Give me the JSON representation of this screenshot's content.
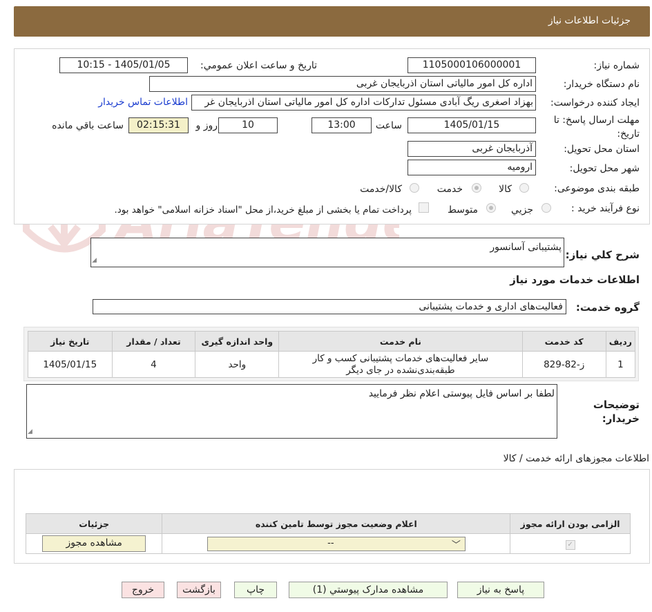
{
  "header": {
    "title": "جزئیات اطلاعات نیاز"
  },
  "form": {
    "need_number_label": "شماره نیاز:",
    "need_number": "1105000106000001",
    "announce_label": "تاریخ و ساعت اعلان عمومي:",
    "announce_value": "1405/01/05 - 10:15",
    "buyer_org_label": "نام دستگاه خریدار:",
    "buyer_org": "اداره کل امور مالیاتی استان اذربایجان غربی",
    "creator_label": "ایجاد کننده درخواست:",
    "creator": "بهزاد اصغری ریگ آبادی مسئول تدارکات اداره کل امور مالیاتی استان اذربایجان غر",
    "contact_link": "اطلاعات تماس خریدار",
    "deadline_label": "مهلت ارسال پاسخ: تا تاریخ:",
    "deadline_date": "1405/01/15",
    "time_label": "ساعت",
    "deadline_time": "13:00",
    "days": "10",
    "days_label": "روز و",
    "remaining": "02:15:31",
    "remaining_label": "ساعت باقي مانده",
    "province_label": "استان محل تحویل:",
    "province": "آذربایجان غربی",
    "city_label": "شهر محل تحویل:",
    "city": "ارومیه",
    "category_label": "طبقه بندی موضوعی:",
    "category_options": [
      "کالا",
      "خدمت",
      "کالا/خدمت"
    ],
    "category_selected": "خدمت",
    "process_label": "نوع فرآیند خرید :",
    "process_options": [
      "جزيي",
      "متوسط"
    ],
    "process_selected": "متوسط",
    "payment_note": "پرداخت تمام یا بخشی از مبلغ خرید،از محل \"اسناد خزانه اسلامی\" خواهد بود."
  },
  "summary": {
    "label": "شرح کلي نیاز:",
    "value": "پشتیبانی آسانسور"
  },
  "services": {
    "section_title": "اطلاعات خدمات مورد نیاز",
    "group_label": "گروه خدمت:",
    "group_value": "فعالیت‌های اداری و خدمات پشتیبانی",
    "columns": [
      "ردیف",
      "کد خدمت",
      "نام خدمت",
      "واحد اندازه گیری",
      "تعداد / مقدار",
      "تاریخ نیاز"
    ],
    "rows": [
      {
        "row": "1",
        "code": "ز-82-829",
        "name_line1": "سایر فعالیت‌های خدمات پشتیبانی کسب و کار",
        "name_line2": "طبقه‌بندی‌نشده در جای دیگر",
        "unit": "واحد",
        "qty": "4",
        "date": "1405/01/15"
      }
    ]
  },
  "buyer_notes": {
    "label": "توضیحات خریدار:",
    "value": "لطفا بر اساس فایل پیوستی اعلام نظر فرمایید"
  },
  "permits": {
    "section_title": "اطلاعات مجوزهای ارائه خدمت / کالا",
    "columns": [
      "الزامی بودن ارائه مجوز",
      "اعلام وضعیت مجوز توسط تامین کننده",
      "جزئیات"
    ],
    "select_value": "--",
    "view_button": "مشاهده مجوز"
  },
  "buttons": {
    "reply": "پاسخ به نیاز",
    "attachments": "مشاهده مدارک پیوستي (1)",
    "print": "چاپ",
    "back": "بازگشت",
    "exit": "خروج"
  },
  "watermark_text": "AriaTender.neT",
  "colors": {
    "header_bg": "#8b6a3f",
    "link": "#1a3ccf",
    "remaining_bg": "#f4f0c8",
    "reply_bg": "#f0fbe6",
    "back_bg": "#fbe2e2"
  }
}
